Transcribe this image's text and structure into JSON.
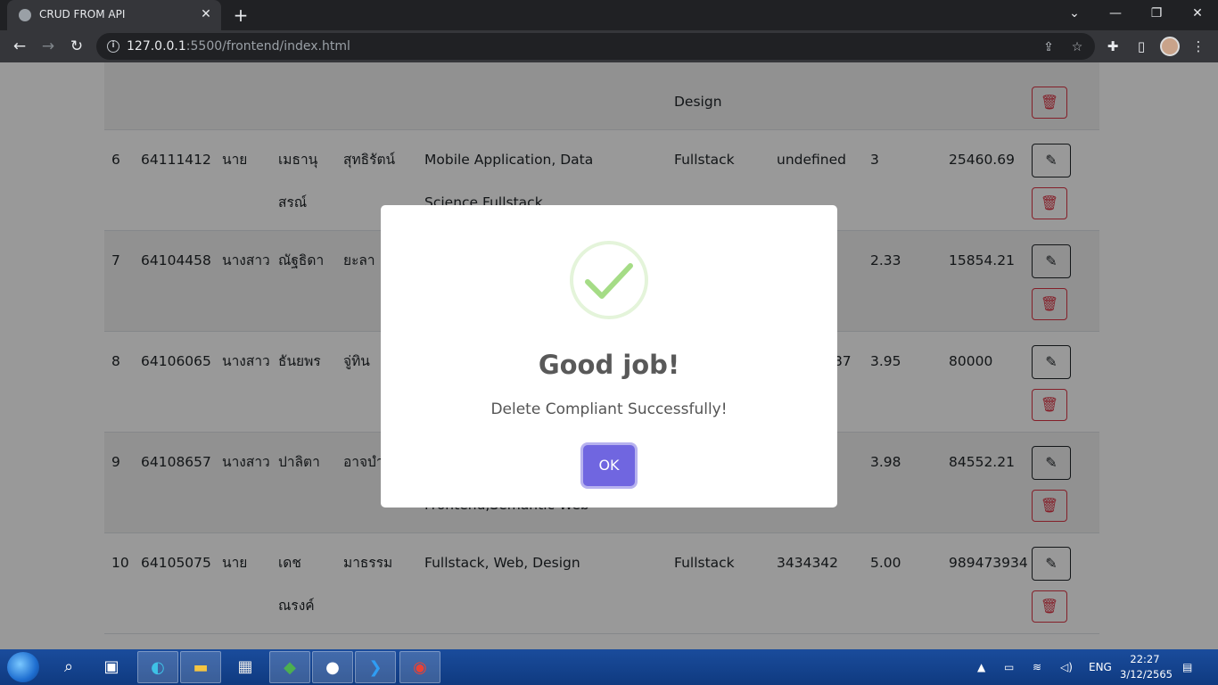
{
  "browser": {
    "tab_title": "CRUD FROM API",
    "url_host": "127.0.0.1",
    "url_path": ":5500/frontend/index.html"
  },
  "table_rows": [
    {
      "no": "",
      "id": "",
      "prefix": "",
      "first": "",
      "last": "",
      "interest": "",
      "interest2": "Design",
      "position": "",
      "phone": "",
      "gpa": "",
      "salary": ""
    },
    {
      "no": "6",
      "id": "64111412",
      "prefix": "นาย",
      "first": "เมธานุ",
      "first2": "สรณ์",
      "last": "สุทธิรัตน์",
      "interest": "Mobile Application, Data",
      "interest2": "Science Fullstack",
      "position": "Fullstack",
      "phone": "undefined",
      "gpa": "3",
      "salary": "25460.69"
    },
    {
      "no": "7",
      "id": "64104458",
      "prefix": "นางสาว",
      "first": "ณัฐธิดา",
      "first2": "",
      "last": "ยะลา",
      "interest": "",
      "interest2": "",
      "position": "",
      "phone": "",
      "gpa": "2.33",
      "salary": "15854.21"
    },
    {
      "no": "8",
      "id": "64106065",
      "prefix": "นางสาว",
      "first": "ธันยพร",
      "first2": "",
      "last": "จู่ทิน",
      "interest": "",
      "interest2": "",
      "position": "",
      "phone": ".87",
      "gpa": "3.95",
      "salary": "80000"
    },
    {
      "no": "9",
      "id": "64108657",
      "prefix": "นางสาว",
      "first": "ปาลิตา",
      "first2": "",
      "last": "อาจบำ",
      "interest": "",
      "interest2": "Frontend,Semantic Web",
      "position": "",
      "phone": "",
      "gpa": "3.98",
      "salary": "84552.21"
    },
    {
      "no": "10",
      "id": "64105075",
      "prefix": "นาย",
      "first": "เดช",
      "first2": "ณรงค์",
      "last": "มาธรรม",
      "interest": "Fullstack, Web, Design",
      "interest2": "",
      "position": "Fullstack",
      "phone": "3434342",
      "gpa": "5.00",
      "salary": "989473934"
    }
  ],
  "modal": {
    "title": "Good job!",
    "text": "Delete Compliant Successfully!",
    "ok_label": "OK",
    "success_color": "#a5dc86",
    "button_color": "#7066e0"
  },
  "taskbar": {
    "language": "ENG",
    "time": "22:27",
    "date": "3/12/2565"
  }
}
